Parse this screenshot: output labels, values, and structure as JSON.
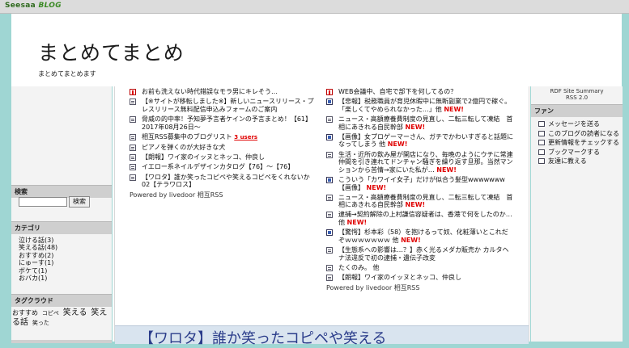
{
  "topbar": {
    "logo_text": "Seesaa",
    "logo_blog": "BLOG"
  },
  "header": {
    "title": "まとめてまとめ",
    "description": "まとめてまとめます"
  },
  "left": {
    "search_heading": "検索",
    "search_button": "検索",
    "category_heading": "カテゴリ",
    "categories": [
      "泣ける話(3)",
      "笑える話(48)",
      "おすすめ(2)",
      "にゅーす(1)",
      "ボケて(1)",
      "おバカ(1)"
    ],
    "tagcloud_heading": "タグクラウド",
    "tags": [
      "おすすめ",
      "コピペ",
      "笑える",
      "笑える話",
      "笑った"
    ]
  },
  "main": {
    "left_items": [
      {
        "icon": "red",
        "text": "お前も洗えない時代錯誤なモラ男にキレそう…"
      },
      {
        "icon": "doc",
        "text": "【※サイトが移転しました※】新しいニュースリリース・プレスリリース無料配信申込みフォームのご案内"
      },
      {
        "icon": "doc",
        "text": "脅威の的中率！予知夢予言者ケインの予言まとめ！【61】2017年08月26日～"
      },
      {
        "icon": "doc",
        "text": "相互RSS募集中のブログリスト",
        "users": "3 users"
      },
      {
        "icon": "doc",
        "text": "ピアノを弾くのが大好きな犬"
      },
      {
        "icon": "doc",
        "text": "【朗報】ワイ家のイッヌとネッコ、仲良し"
      },
      {
        "icon": "doc",
        "text": "イエロー系ネイルデザインカタログ【76】～【76】"
      },
      {
        "icon": "doc",
        "text": "【ワロタ】誰か笑ったコピペや笑えるコピペをくれないか　02【テラワロス】"
      }
    ],
    "left_powered": "Powered by livedoor 相互RSS",
    "right_items": [
      {
        "icon": "red",
        "text": "WEB会議中、自宅で部下を何してるの？"
      },
      {
        "icon": "img",
        "text": "【悲報】税務職員が育児休暇中に無断副業で2億円で稼ぐ。「楽しくてやめられなかった…」他",
        "new": "NEW!"
      },
      {
        "icon": "doc",
        "text": "ニュース・高額療養費制度の見直し、二転三転して凍結　首相にあきれる自民幹部",
        "new": "NEW!"
      },
      {
        "icon": "img",
        "text": "【画像】女プロゲーマーさん、ガチでかわいすぎると話題になってしまう 他",
        "new": "NEW!"
      },
      {
        "icon": "doc",
        "text": "生活・近所の飲み屋が開店になり、毎晩のようにウチに常連仲間を引き連れてドンチャン騒ぎを繰り返す旦那。当然マンションから苦情→家にいた私が…",
        "new": "NEW!"
      },
      {
        "icon": "img",
        "text": "こういう「カワイイ女子」だけが似合う髪型wwwwwww【画像】",
        "new": "NEW!"
      },
      {
        "icon": "doc",
        "text": "ニュース・高額療養費制度の見直し、二転三転して凍結　首相にあきれる自民幹部",
        "new": "NEW!"
      },
      {
        "icon": "doc",
        "text": "逮捕→契約解除の上村謙信容疑者は、香港で何をしたのか… 他",
        "new": "NEW!"
      },
      {
        "icon": "img",
        "text": "【驚愕】杉本彩（58）を抱けるって奴、化粧薄いとこれだぞｗｗｗｗｗｗｗ 他",
        "new": "NEW!"
      },
      {
        "icon": "doc",
        "text": "【生態系への影響は…？】赤く光るメダカ販売か カルタヘナ法違反で初の逮捕・遺伝子改変"
      },
      {
        "icon": "doc",
        "text": "たくのみ。 他"
      },
      {
        "icon": "doc",
        "text": "【朗報】ワイ家のイッヌとネッコ、仲良し"
      }
    ],
    "right_powered": "Powered by livedoor 相互RSS",
    "banner_text": "【ワロタ】誰か笑ったコピペや笑える"
  },
  "right": {
    "rdf_label": "RDF Site Summary",
    "rss_label": "RSS 2.0",
    "fan_heading": "ファン",
    "fan_items": [
      "メッセージを送る",
      "このブログの読者になる",
      "更新情報をチェックする",
      "ブックマークする",
      "友達に教える"
    ]
  }
}
